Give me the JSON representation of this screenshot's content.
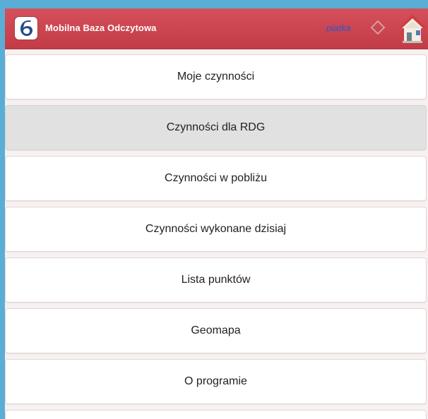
{
  "header": {
    "title": "Mobilna Baza Odczytowa",
    "user": "piatka",
    "logo_icon": "app-logo-icon",
    "settings_icon": "diamond-icon",
    "home_icon": "home-icon"
  },
  "menu": {
    "items": [
      {
        "label": "Moje czynności",
        "active": false
      },
      {
        "label": "Czynności dla RDG",
        "active": true
      },
      {
        "label": "Czynności w pobliżu",
        "active": false
      },
      {
        "label": "Czynności wykonane dzisiaj",
        "active": false
      },
      {
        "label": "Lista punktów",
        "active": false
      },
      {
        "label": "Geomapa",
        "active": false
      },
      {
        "label": "O programie",
        "active": false
      }
    ]
  },
  "colors": {
    "header": "#c9444f",
    "background": "#f7f2f1",
    "frame": "#5aaed6",
    "active_item": "#e1e1e1"
  }
}
